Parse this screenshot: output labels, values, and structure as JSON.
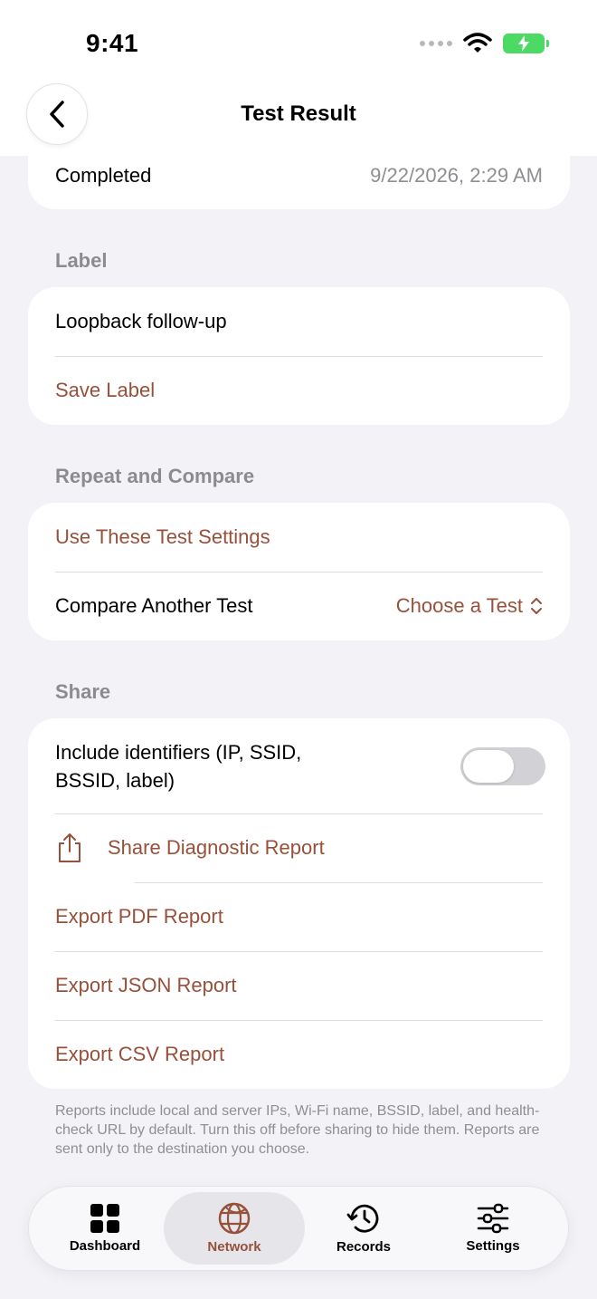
{
  "status": {
    "time": "9:41"
  },
  "nav": {
    "title": "Test Result",
    "back_icon": "chevron-left-icon"
  },
  "completed": {
    "label": "Completed",
    "value": "9/22/2026, 2:29 AM"
  },
  "label_section": {
    "header": "Label",
    "value": "Loopback follow-up",
    "save": "Save Label"
  },
  "repeat_section": {
    "header": "Repeat and Compare",
    "use_settings": "Use These Test Settings",
    "compare_label": "Compare Another Test",
    "compare_value": "Choose a Test"
  },
  "share_section": {
    "header": "Share",
    "include_line1": "Include identifiers (IP, SSID,",
    "include_line2": "BSSID, label)",
    "include_on": false,
    "share_report": "Share Diagnostic Report",
    "export_pdf": "Export PDF Report",
    "export_json": "Export JSON Report",
    "export_csv": "Export CSV Report",
    "footnote": "Reports include local and server IPs, Wi-Fi name, BSSID, label, and health-check URL by default. Turn this off before sharing to hide them. Reports are sent only to the destination you choose."
  },
  "tabs": [
    {
      "label": "Dashboard",
      "icon": "grid-icon",
      "active": false
    },
    {
      "label": "Network",
      "icon": "globe-icon",
      "active": true
    },
    {
      "label": "Records",
      "icon": "history-icon",
      "active": false
    },
    {
      "label": "Settings",
      "icon": "sliders-icon",
      "active": false
    }
  ],
  "colors": {
    "accent": "#97503a",
    "background": "#f2f2f7",
    "battery": "#4cd964"
  }
}
